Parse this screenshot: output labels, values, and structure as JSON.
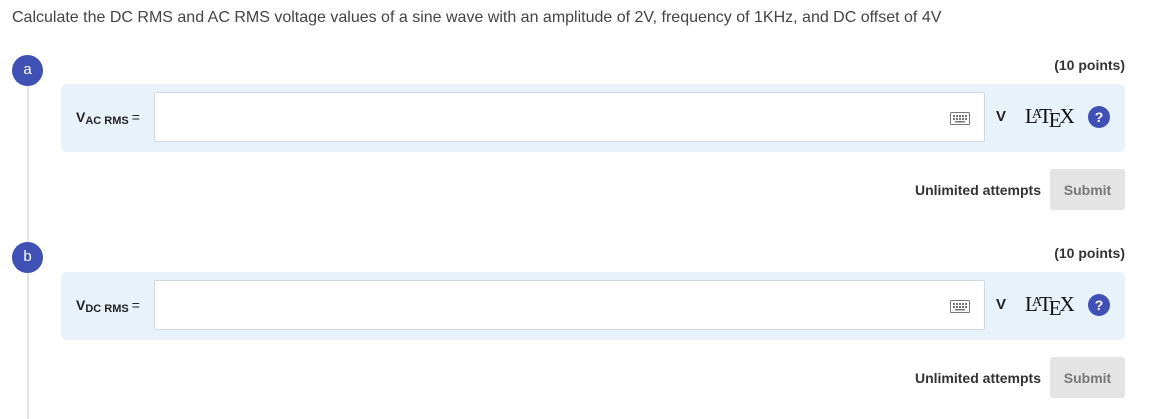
{
  "question": {
    "text": "Calculate the DC RMS and AC RMS voltage values of a sine wave with an amplitude of 2V, frequency of 1KHz, and DC offset of 4V"
  },
  "parts": [
    {
      "badge": "a",
      "points": "(10 points)",
      "var_main": "V",
      "var_sub": "AC RMS",
      "equals": "=",
      "input_value": "",
      "unit": "V",
      "help_label": "?",
      "attempts": "Unlimited attempts",
      "submit_label": "Submit"
    },
    {
      "badge": "b",
      "points": "(10 points)",
      "var_main": "V",
      "var_sub": "DC RMS",
      "equals": "=",
      "input_value": "",
      "unit": "V",
      "help_label": "?",
      "attempts": "Unlimited attempts",
      "submit_label": "Submit"
    }
  ],
  "latex_logo": "LaTeX",
  "icons": {
    "keyboard": "keyboard-icon",
    "help": "question-mark-icon"
  },
  "colors": {
    "accent": "#3f51b5",
    "answer_bg": "#e8f2fb",
    "submit_bg": "#e4e4e4"
  }
}
